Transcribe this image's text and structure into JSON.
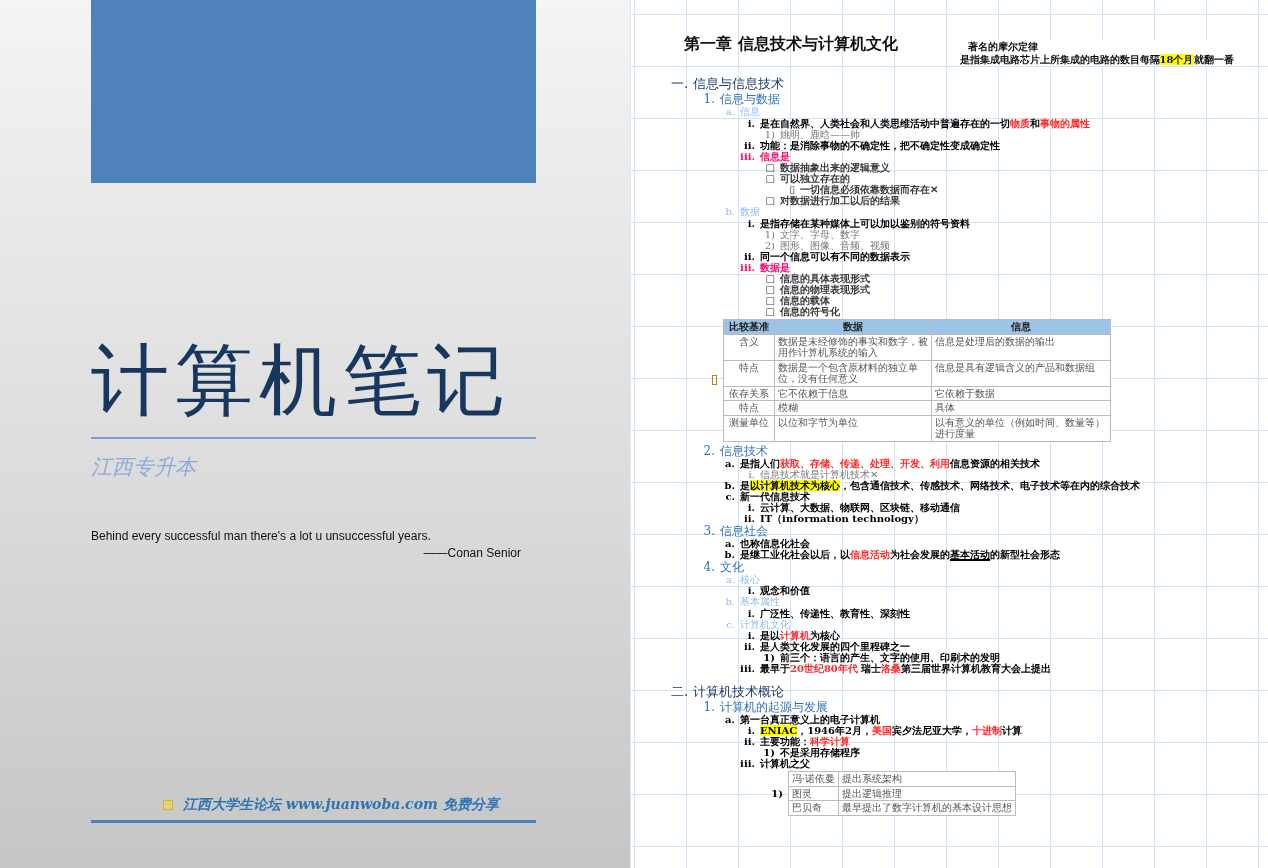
{
  "cover": {
    "title": "计算机笔记",
    "subtitle": "江西专升本",
    "quote": "Behind every successful man there's a lot u unsuccessful years.",
    "attribution": "——Conan Senior",
    "footer": "江西大学生论坛 www.juanwoba.com 免费分享"
  },
  "notes_page": {
    "chapter_title": "第一章 信息技术与计算机文化",
    "side_note": {
      "title": "著名的摩尔定律",
      "text": [
        {
          "text": "是指集成电路芯片上所集成的电路的数目每隔",
          "kind": "plain"
        },
        {
          "text": "18个月",
          "kind": "highlight"
        },
        {
          "text": "就翻一番",
          "kind": "plain"
        }
      ]
    },
    "outline": [
      {
        "kind": "section",
        "marker": "一.",
        "text": [
          {
            "text": "信息与信息技术",
            "kind": "plain"
          }
        ],
        "children": [
          {
            "kind": "heading",
            "marker": "1.",
            "text": [
              {
                "text": "信息与数据",
                "kind": "plain"
              }
            ],
            "children": [
              {
                "kind": "topic",
                "marker": "a.",
                "text": [
                  {
                    "text": "信息",
                    "kind": "plain"
                  }
                ],
                "children": [
                  {
                    "kind": "item",
                    "marker": "i.",
                    "text": [
                      {
                        "text": "是在自然界、人类社会和人类思维活动中普遍存在的一切",
                        "kind": "plain"
                      },
                      {
                        "text": "物质",
                        "kind": "red"
                      },
                      {
                        "text": "和",
                        "kind": "plain"
                      },
                      {
                        "text": "事物的属性",
                        "kind": "red"
                      }
                    ],
                    "children": [
                      {
                        "kind": "note",
                        "marker": "1)",
                        "text": [
                          {
                            "text": "姚明、鹿晗——帅",
                            "kind": "plain"
                          }
                        ]
                      }
                    ]
                  },
                  {
                    "kind": "item",
                    "marker": "ii.",
                    "text": [
                      {
                        "text": "功能：是消除事物的不确定性，把不确定性变成确定性",
                        "kind": "plain"
                      }
                    ]
                  },
                  {
                    "kind": "emphasis",
                    "marker": "iii.",
                    "text": [
                      {
                        "text": "信息是",
                        "kind": "plain"
                      }
                    ],
                    "children": [
                      {
                        "kind": "bullet",
                        "marker": "□",
                        "text": [
                          {
                            "text": "数据抽象出来的逻辑意义",
                            "kind": "plain"
                          }
                        ]
                      },
                      {
                        "kind": "bullet",
                        "marker": "□",
                        "text": [
                          {
                            "text": "可以独立存在的",
                            "kind": "plain"
                          }
                        ],
                        "children": [
                          {
                            "kind": "bullet",
                            "marker": "▯",
                            "text": [
                              {
                                "text": "一切信息必须依靠数据而存在✕",
                                "kind": "plain"
                              }
                            ]
                          }
                        ]
                      },
                      {
                        "kind": "bullet",
                        "marker": "□",
                        "text": [
                          {
                            "text": "对数据进行加工以后的结果",
                            "kind": "plain"
                          }
                        ]
                      }
                    ]
                  }
                ]
              },
              {
                "kind": "topic",
                "marker": "b.",
                "text": [
                  {
                    "text": "数据",
                    "kind": "plain"
                  }
                ],
                "children": [
                  {
                    "kind": "item",
                    "marker": "i.",
                    "text": [
                      {
                        "text": "是指存储在某种媒体上可以加以鉴别的符号资料",
                        "kind": "plain"
                      }
                    ],
                    "children": [
                      {
                        "kind": "note",
                        "marker": "1)",
                        "text": [
                          {
                            "text": "文字、字母、数字",
                            "kind": "plain"
                          }
                        ]
                      },
                      {
                        "kind": "note",
                        "marker": "2)",
                        "text": [
                          {
                            "text": "图形、图像、音频、视频",
                            "kind": "plain"
                          }
                        ]
                      }
                    ]
                  },
                  {
                    "kind": "item",
                    "marker": "ii.",
                    "text": [
                      {
                        "text": "同一个信息可以有不同的数据表示",
                        "kind": "plain"
                      }
                    ]
                  },
                  {
                    "kind": "emphasis",
                    "marker": "iii.",
                    "text": [
                      {
                        "text": "数据是",
                        "kind": "plain"
                      }
                    ],
                    "children": [
                      {
                        "kind": "bullet",
                        "marker": "□",
                        "text": [
                          {
                            "text": "信息的具体表现形式",
                            "kind": "plain"
                          }
                        ]
                      },
                      {
                        "kind": "bullet",
                        "marker": "□",
                        "text": [
                          {
                            "text": "信息的物理表现形式",
                            "kind": "plain"
                          }
                        ]
                      },
                      {
                        "kind": "bullet",
                        "marker": "□",
                        "text": [
                          {
                            "text": "信息的载体",
                            "kind": "plain"
                          }
                        ]
                      },
                      {
                        "kind": "bullet",
                        "marker": "□",
                        "text": [
                          {
                            "text": "信息的符号化",
                            "kind": "plain"
                          }
                        ]
                      }
                    ]
                  },
                  {
                    "kind": "table",
                    "columns": [
                      "比较基准",
                      "数据",
                      "信息"
                    ],
                    "rows": [
                      [
                        "含义",
                        "数据是未经修饰的事实和数字，被用作计算机系统的输入",
                        "信息是处理后的数据的输出"
                      ],
                      [
                        "特点",
                        "数据是一个包含原材料的独立单位，没有任何意义",
                        "信息是具有逻辑含义的产品和数据组"
                      ],
                      [
                        "依存关系",
                        "它不依赖于信息",
                        "它依赖于数据"
                      ],
                      [
                        "特点",
                        "模糊",
                        "具体"
                      ],
                      [
                        "测量单位",
                        "以位和字节为单位",
                        "以有意义的单位（例如时间、数量等）进行度量"
                      ]
                    ]
                  }
                ]
              }
            ]
          },
          {
            "kind": "heading",
            "marker": "2.",
            "text": [
              {
                "text": "信息技术",
                "kind": "plain"
              }
            ],
            "children": [
              {
                "kind": "item",
                "marker": "a.",
                "text": [
                  {
                    "text": "是指人们",
                    "kind": "plain"
                  },
                  {
                    "text": "获取、存储、传递、处理、开发、利用",
                    "kind": "red"
                  },
                  {
                    "text": "信息资源的相关技术",
                    "kind": "plain"
                  }
                ],
                "children": [
                  {
                    "kind": "note",
                    "marker": "i.",
                    "text": [
                      {
                        "text": "信息技术就是计算机技术✕",
                        "kind": "plain"
                      }
                    ]
                  }
                ]
              },
              {
                "kind": "item",
                "marker": "b.",
                "text": [
                  {
                    "text": "是",
                    "kind": "plain"
                  },
                  {
                    "text": "以计算机技术为核心",
                    "kind": "highlight"
                  },
                  {
                    "text": "，包含通信技术、传感技术、网络技术、电子技术等在内的综合技术",
                    "kind": "plain"
                  }
                ]
              },
              {
                "kind": "item",
                "marker": "c.",
                "text": [
                  {
                    "text": "新一代信息技术",
                    "kind": "plain"
                  }
                ],
                "children": [
                  {
                    "kind": "item",
                    "marker": "i.",
                    "text": [
                      {
                        "text": "云计算、大数据、物联网、区块链、移动通信",
                        "kind": "plain"
                      }
                    ]
                  },
                  {
                    "kind": "item",
                    "marker": "ii.",
                    "text": [
                      {
                        "text": "IT（information technology）",
                        "kind": "plain"
                      }
                    ]
                  }
                ]
              }
            ]
          },
          {
            "kind": "heading",
            "marker": "3.",
            "text": [
              {
                "text": "信息社会",
                "kind": "plain"
              }
            ],
            "children": [
              {
                "kind": "item",
                "marker": "a.",
                "text": [
                  {
                    "text": "也称信息化社会",
                    "kind": "plain"
                  }
                ]
              },
              {
                "kind": "item",
                "marker": "b.",
                "text": [
                  {
                    "text": "是继工业化社会以后，以",
                    "kind": "plain"
                  },
                  {
                    "text": "信息活动",
                    "kind": "red"
                  },
                  {
                    "text": "为社会发展的",
                    "kind": "plain"
                  },
                  {
                    "text": "基本活动",
                    "kind": "underline"
                  },
                  {
                    "text": "的新型社会形态",
                    "kind": "plain"
                  }
                ]
              }
            ]
          },
          {
            "kind": "heading",
            "marker": "4.",
            "text": [
              {
                "text": "文化",
                "kind": "plain"
              }
            ],
            "children": [
              {
                "kind": "topic",
                "marker": "a.",
                "text": [
                  {
                    "text": "核心",
                    "kind": "plain"
                  }
                ],
                "children": [
                  {
                    "kind": "item",
                    "marker": "i.",
                    "text": [
                      {
                        "text": "观念和价值",
                        "kind": "plain"
                      }
                    ]
                  }
                ]
              },
              {
                "kind": "topic",
                "marker": "b.",
                "text": [
                  {
                    "text": "基本属性",
                    "kind": "plain"
                  }
                ],
                "children": [
                  {
                    "kind": "item",
                    "marker": "i.",
                    "text": [
                      {
                        "text": "广泛性、传递性、教育性、深刻性",
                        "kind": "plain"
                      }
                    ]
                  }
                ]
              },
              {
                "kind": "topic",
                "marker": "c.",
                "text": [
                  {
                    "text": "计算机文化",
                    "kind": "plain"
                  }
                ],
                "children": [
                  {
                    "kind": "item",
                    "marker": "i.",
                    "text": [
                      {
                        "text": "是以",
                        "kind": "plain"
                      },
                      {
                        "text": "计算机",
                        "kind": "red"
                      },
                      {
                        "text": "为核心",
                        "kind": "plain"
                      }
                    ]
                  },
                  {
                    "kind": "item",
                    "marker": "ii.",
                    "text": [
                      {
                        "text": "是人类文化发展的四个里程碑之一",
                        "kind": "plain"
                      }
                    ],
                    "children": [
                      {
                        "kind": "item",
                        "marker": "1)",
                        "text": [
                          {
                            "text": "前三个：语言的产生、文字的使用、印刷术的发明",
                            "kind": "plain"
                          }
                        ]
                      }
                    ]
                  },
                  {
                    "kind": "item",
                    "marker": "iii.",
                    "text": [
                      {
                        "text": "最早于",
                        "kind": "plain"
                      },
                      {
                        "text": "20世纪80年代",
                        "kind": "red"
                      },
                      {
                        "text": " 瑞士",
                        "kind": "plain"
                      },
                      {
                        "text": "洛桑",
                        "kind": "red"
                      },
                      {
                        "text": "第三届世界计算机教育大会上提出",
                        "kind": "plain"
                      }
                    ]
                  }
                ]
              }
            ]
          }
        ]
      },
      {
        "kind": "section",
        "marker": "二.",
        "text": [
          {
            "text": "计算机技术概论",
            "kind": "plain"
          }
        ],
        "children": [
          {
            "kind": "heading",
            "marker": "1.",
            "text": [
              {
                "text": "计算机的起源与发展",
                "kind": "plain"
              }
            ],
            "children": [
              {
                "kind": "item",
                "marker": "a.",
                "text": [
                  {
                    "text": "第一台真正意义上的电子计算机",
                    "kind": "plain"
                  }
                ],
                "children": [
                  {
                    "kind": "item",
                    "marker": "i.",
                    "text": [
                      {
                        "text": "ENIAC",
                        "kind": "highlight"
                      },
                      {
                        "text": "，1946年2月，",
                        "kind": "plain"
                      },
                      {
                        "text": "美国",
                        "kind": "red"
                      },
                      {
                        "text": "宾夕法尼亚大学，",
                        "kind": "plain"
                      },
                      {
                        "text": "十进制",
                        "kind": "red"
                      },
                      {
                        "text": "计算",
                        "kind": "plain"
                      }
                    ]
                  },
                  {
                    "kind": "item",
                    "marker": "ii.",
                    "text": [
                      {
                        "text": "主要功能：",
                        "kind": "plain"
                      },
                      {
                        "text": "科学计算",
                        "kind": "red"
                      }
                    ],
                    "children": [
                      {
                        "kind": "item",
                        "marker": "1)",
                        "text": [
                          {
                            "text": "不是采用存储程序",
                            "kind": "plain"
                          }
                        ]
                      }
                    ]
                  },
                  {
                    "kind": "item",
                    "marker": "iii.",
                    "text": [
                      {
                        "text": "计算机之父",
                        "kind": "plain"
                      }
                    ],
                    "children": [
                      {
                        "kind": "table",
                        "marker": "1)",
                        "rows": [
                          [
                            "冯·诺依曼",
                            "提出系统架构"
                          ],
                          [
                            "图灵",
                            "提出逻辑推理"
                          ],
                          [
                            "巴贝奇",
                            "最早提出了数字计算机的基本设计思想"
                          ]
                        ]
                      }
                    ]
                  }
                ]
              }
            ]
          }
        ]
      }
    ]
  }
}
